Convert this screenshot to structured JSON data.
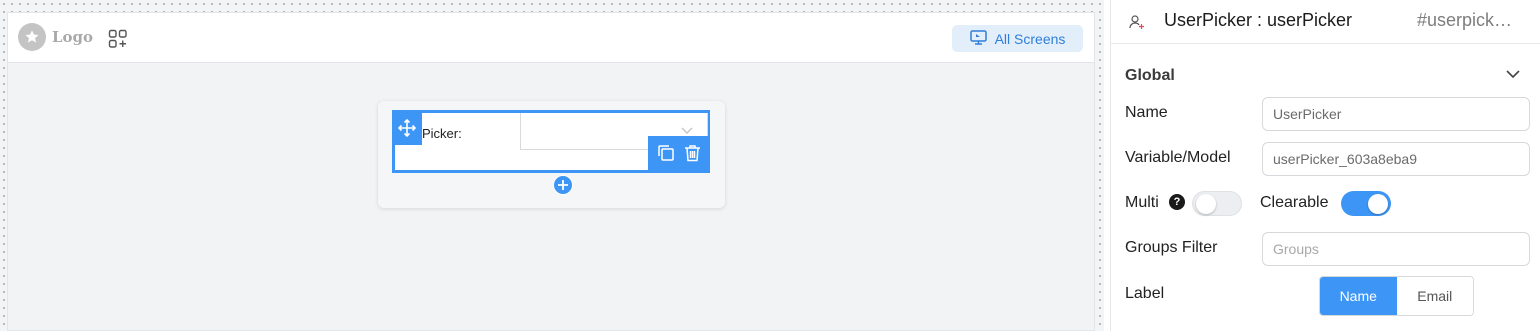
{
  "canvas": {
    "logo_text": "Logo",
    "all_screens_label": "All Screens",
    "widget": {
      "label": "Picker:"
    }
  },
  "panel": {
    "title": "UserPicker : userPicker",
    "component_id": "#userpick…",
    "section": "Global",
    "fields": {
      "name_label": "Name",
      "name_value": "UserPicker",
      "variable_label": "Variable/Model",
      "variable_value": "userPicker_603a8eba9",
      "multi_label": "Multi",
      "multi_help": "?",
      "clearable_label": "Clearable",
      "groups_label": "Groups Filter",
      "groups_placeholder": "Groups",
      "label_label": "Label",
      "label_options": [
        "Name",
        "Email"
      ],
      "label_selected": "Name"
    },
    "toggles": {
      "multi": false,
      "clearable": true
    }
  },
  "colors": {
    "accent": "#3d96f6",
    "accent_soft": "#e3eefb",
    "canvas_bg": "#f2f3f5"
  },
  "icons": [
    "star-icon",
    "apps-add-icon",
    "monitor-icon",
    "move-icon",
    "copy-icon",
    "trash-icon",
    "plus-icon",
    "user-add-icon",
    "chevron-down-icon",
    "help-icon"
  ]
}
